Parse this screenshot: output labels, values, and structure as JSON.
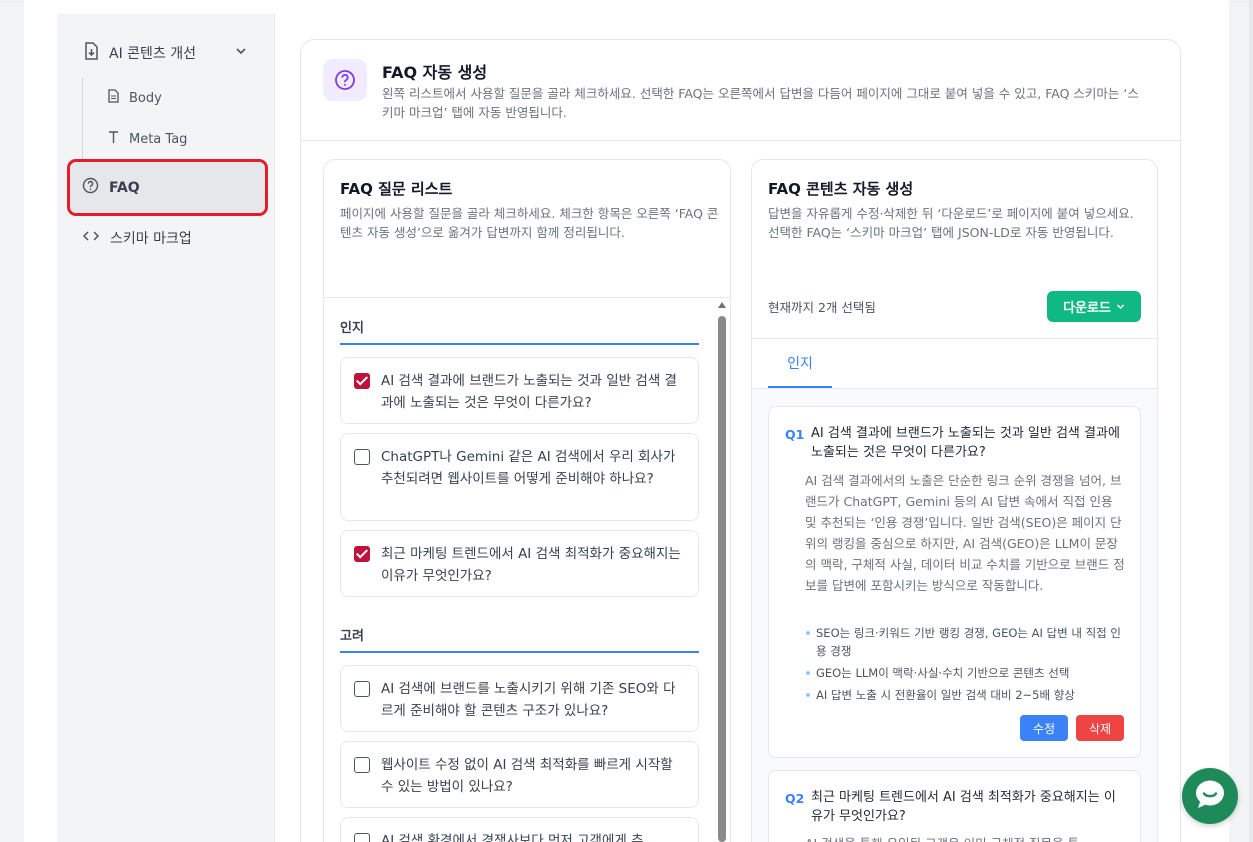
{
  "sidebar": {
    "group_label": "AI 콘텐츠 개선",
    "sub_items": [
      {
        "label": "Body",
        "icon": "document-icon"
      },
      {
        "label": "Meta Tag",
        "icon": "text-icon"
      }
    ],
    "faq_label": "FAQ",
    "schema_label": "스키마 마크업"
  },
  "header": {
    "title": "FAQ 자동 생성",
    "description": "왼쪽 리스트에서 사용할 질문을 골라 체크하세요. 선택한 FAQ는 오른쪽에서 답변을 다듬어 페이지에 그대로 붙여 넣을 수 있고, FAQ 스키마는 ‘스키마 마크업’ 탭에 자동 반영됩니다."
  },
  "question_list": {
    "title": "FAQ 질문 리스트",
    "description": "페이지에 사용할 질문을 골라 체크하세요. 체크한 항목은 오른쪽 ‘FAQ 콘텐츠 자동 생성’으로 옮겨가 답변까지 함께 정리됩니다.",
    "categories": [
      {
        "name": "인지",
        "questions": [
          {
            "text": "AI 검색 결과에 브랜드가 노출되는 것과 일반 검색 결과에 노출되는 것은 무엇이 다른가요?",
            "checked": true
          },
          {
            "text": "ChatGPT나 Gemini 같은 AI 검색에서 우리 회사가 추천되려면 웹사이트를 어떻게 준비해야 하나요?",
            "checked": false
          },
          {
            "text": "최근 마케팅 트렌드에서 AI 검색 최적화가 중요해지는 이유가 무엇인가요?",
            "checked": true
          }
        ]
      },
      {
        "name": "고려",
        "questions": [
          {
            "text": "AI 검색에 브랜드를 노출시키기 위해 기존 SEO와 다르게 준비해야 할 콘텐츠 구조가 있나요?",
            "checked": false
          },
          {
            "text": "웹사이트 수정 없이 AI 검색 최적화를 빠르게 시작할 수 있는 방법이 있나요?",
            "checked": false
          },
          {
            "text": "AI 검색 환경에서 경쟁사보다 먼저 고객에게 추",
            "checked": false
          }
        ]
      }
    ]
  },
  "content_panel": {
    "title": "FAQ 콘텐츠 자동 생성",
    "description_1": "답변을 자유롭게 수정·삭제한 뒤 ‘다운로드’로 페이지에 붙여 넣으세요.",
    "description_2": "선택한 FAQ는 ‘스키마 마크업’ 탭에 JSON-LD로 자동 반영됩니다.",
    "selected_count": "현재까지 2개 선택됨",
    "download_label": "다운로드",
    "tab_label": "인지",
    "faqs": [
      {
        "num": "Q1",
        "question": "AI 검색 결과에 브랜드가 노출되는 것과 일반 검색 결과에 노출되는 것은 무엇이 다른가요?",
        "answer": "AI 검색 결과에서의 노출은 단순한 링크 순위 경쟁을 넘어, 브랜드가 ChatGPT, Gemini 등의 AI 답변 속에서 직접 인용 및 추천되는 ‘인용 경쟁’입니다. 일반 검색(SEO)은 페이지 단위의 랭킹을 중심으로 하지만, AI 검색(GEO)은 LLM이 문장의 맥락, 구체적 사실, 데이터 비교 수치를 기반으로 브랜드 정보를 답변에 포함시키는 방식으로 작동합니다.",
        "bullets": [
          "SEO는 링크·키워드 기반 랭킹 경쟁, GEO는 AI 답변 내 직접 인용 경쟁",
          "GEO는 LLM이 맥락·사실·수치 기반으로 콘텐츠 선택",
          "AI 답변 노출 시 전환율이 일반 검색 대비 2~5배 향상"
        ],
        "edit_label": "수정",
        "delete_label": "삭제"
      },
      {
        "num": "Q2",
        "question": "최근 마케팅 트렌드에서 AI 검색 최적화가 중요해지는 이유가 무엇인가요?",
        "answer": "AI 검색을 통해 유입된 고객은 이미 구체적 질문을 통"
      }
    ]
  },
  "colors": {
    "accent": "#3b82f6",
    "download": "#10b981",
    "delete": "#ef4444",
    "checked": "#be123c",
    "highlight": "#e11d2e",
    "chat": "#1e8a5a"
  }
}
